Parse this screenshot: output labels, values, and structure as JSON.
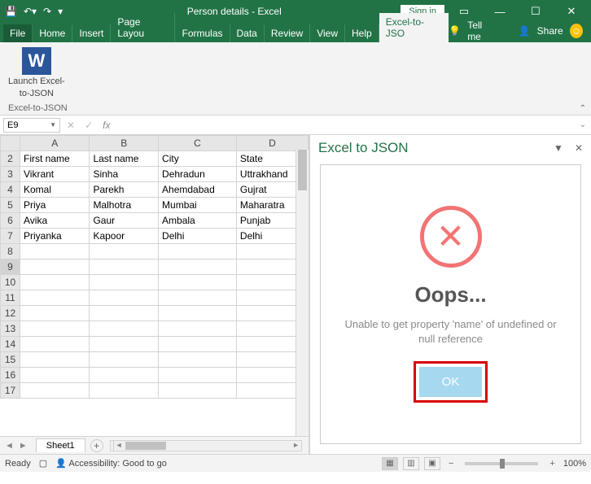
{
  "titlebar": {
    "title": "Person details - Excel",
    "signin": "Sign in"
  },
  "ribbon": {
    "tabs": [
      "File",
      "Home",
      "Insert",
      "Page Layou",
      "Formulas",
      "Data",
      "Review",
      "View",
      "Help",
      "Excel-to-JSO"
    ],
    "activeTab": "Excel-to-JSO",
    "tellMe": "Tell me",
    "share": "Share",
    "group": {
      "buttonLine1": "Launch Excel-",
      "buttonLine2": "to-JSON",
      "section": "Excel-to-JSON"
    }
  },
  "nameBox": "E9",
  "chart_data": {
    "type": "table",
    "headers": [
      "First name",
      "Last name",
      "City",
      "State"
    ],
    "rows": [
      [
        "Vikrant",
        "Sinha",
        "Dehradun",
        "Uttrakhand"
      ],
      [
        "Komal",
        "Parekh",
        "Ahemdabad",
        "Gujrat"
      ],
      [
        "Priya",
        "Malhotra",
        "Mumbai",
        "Maharatra"
      ],
      [
        "Avika",
        "Gaur",
        "Ambala",
        "Punjab"
      ],
      [
        "Priyanka",
        "Kapoor",
        "Delhi",
        "Delhi"
      ]
    ],
    "colLetters": [
      "A",
      "B",
      "C",
      "D"
    ],
    "rowStart": 2,
    "emptyRows": [
      8,
      9,
      10,
      11,
      12,
      13,
      14,
      15,
      16,
      17
    ],
    "selectedRow": 9
  },
  "sheet": {
    "active": "Sheet1"
  },
  "taskpane": {
    "title": "Excel to JSON",
    "errTitle": "Oops...",
    "errMsg": "Unable to get property 'name' of undefined or null reference",
    "ok": "OK"
  },
  "statusbar": {
    "ready": "Ready",
    "accessibility": "Accessibility: Good to go",
    "zoom": "100%"
  }
}
